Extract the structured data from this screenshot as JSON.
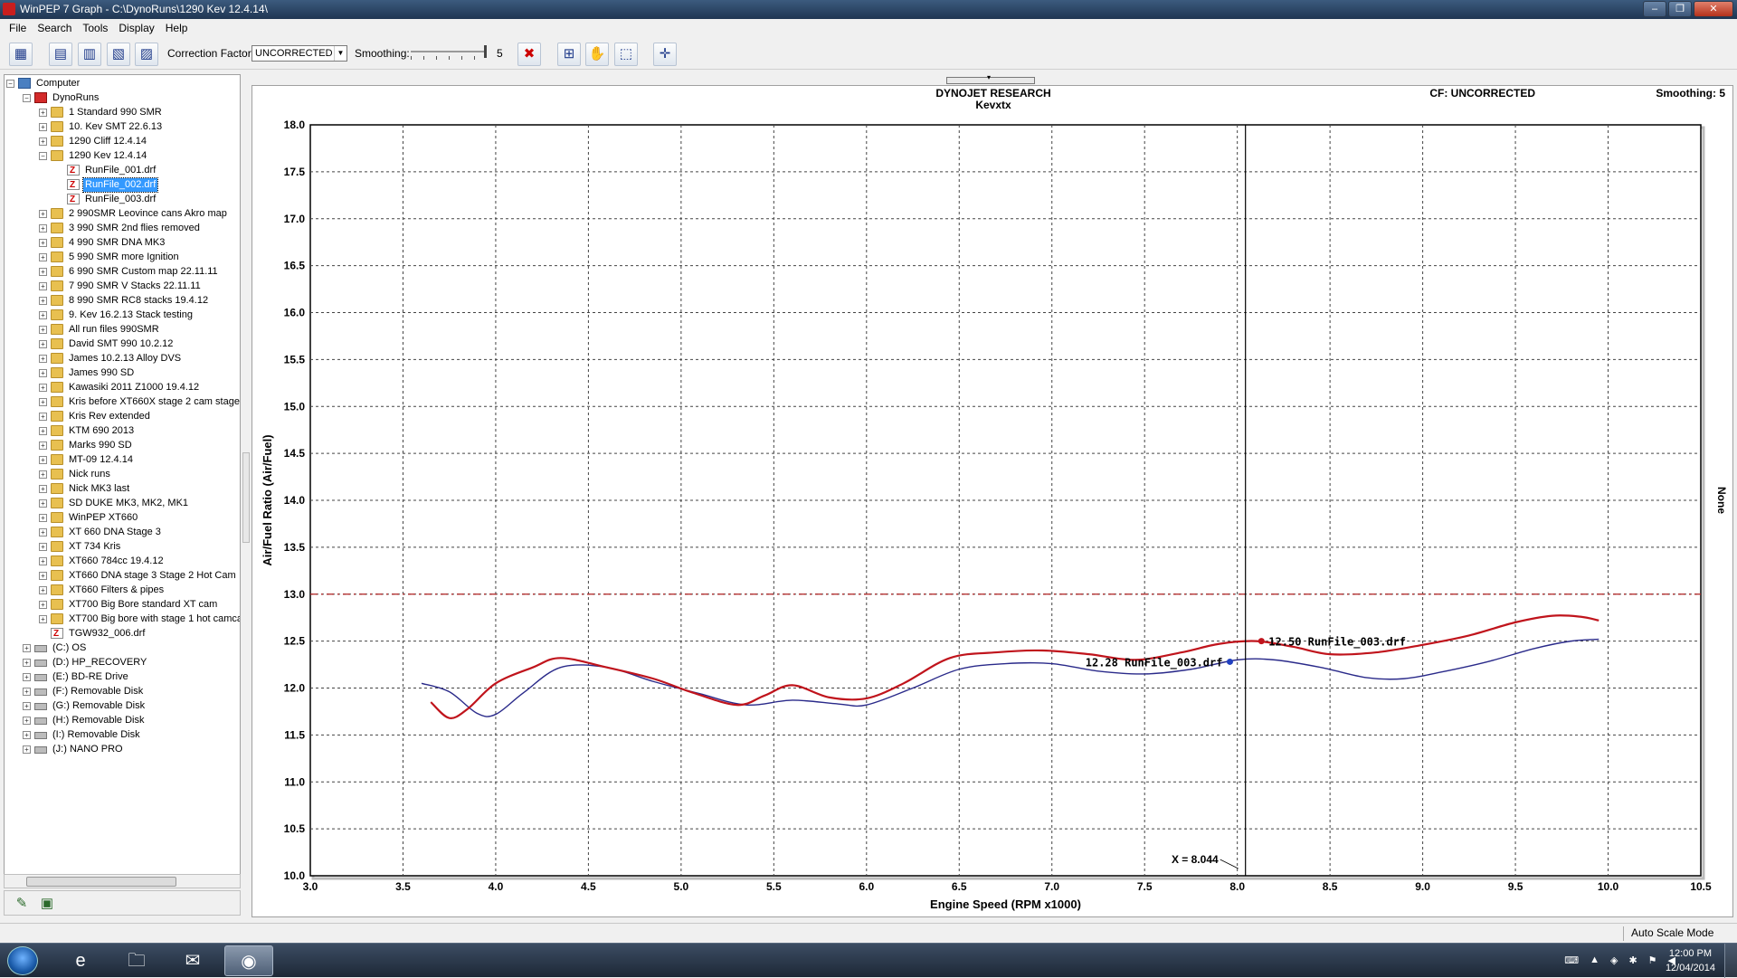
{
  "window": {
    "title": "WinPEP 7    Graph - C:\\DynoRuns\\1290 Kev 12.4.14\\"
  },
  "menu": [
    "File",
    "Search",
    "Tools",
    "Display",
    "Help"
  ],
  "toolbar": {
    "correction_label": "Correction Factor:",
    "correction_value": "UNCORRECTED",
    "smoothing_label": "Smoothing:",
    "smoothing_value": "5"
  },
  "tree": {
    "root": "Computer",
    "dyno_folder": "DynoRuns",
    "items": [
      "1 Standard 990 SMR",
      "10. Kev SMT 22.6.13",
      "1290 Cliff 12.4.14",
      "1290 Kev 12.4.14",
      "RunFile_001.drf",
      "RunFile_002.drf",
      "RunFile_003.drf",
      "2 990SMR Leovince cans Akro map",
      "3 990 SMR 2nd flies removed",
      "4 990 SMR DNA MK3",
      "5 990 SMR more Ignition",
      "6 990 SMR Custom map 22.11.11",
      "7 990 SMR  V Stacks 22.11.11",
      "8 990 SMR RC8 stacks 19.4.12",
      "9. Kev 16.2.13 Stack testing",
      "All run files 990SMR",
      "David SMT 990 10.2.12",
      "James 10.2.13 Alloy DVS",
      "James 990 SD",
      "Kawasiki 2011 Z1000 19.4.12",
      "Kris before XT660X stage 2 cam stage",
      "Kris Rev extended",
      "KTM 690 2013",
      "Marks 990 SD",
      "MT-09 12.4.14",
      "Nick  runs",
      "Nick MK3 last",
      "SD DUKE MK3, MK2, MK1",
      "WinPEP XT660",
      "XT 660 DNA Stage 3",
      "XT 734 Kris",
      "XT660 784cc 19.4.12",
      "XT660 DNA stage 3 Stage 2 Hot Cam",
      "XT660 Filters & pipes",
      "XT700 Big Bore standard XT cam",
      "XT700 Big bore with stage 1 hot camca",
      "TGW932_006.drf"
    ],
    "drives": [
      "(C:)  OS",
      "(D:)  HP_RECOVERY",
      "(E:)  BD-RE Drive",
      "(F:)  Removable Disk",
      "(G:)  Removable Disk",
      "(H:)  Removable Disk",
      "(I:)  Removable Disk",
      "(J:)  NANO PRO"
    ]
  },
  "graph": {
    "title": "DYNOJET RESEARCH",
    "subtitle": "Kevxtx",
    "cf_info": "CF: UNCORRECTED",
    "smoothing_info": "Smoothing: 5",
    "right_axis_label": "None",
    "cursor_readout": "X = 8.044",
    "red_label": "12.50 RunFile_003.drf",
    "blue_label": "12.28 RunFile_003.drf"
  },
  "chart_data": {
    "type": "line",
    "xlabel": "Engine Speed (RPM x1000)",
    "ylabel": "Air/Fuel Ratio (Air/Fuel)",
    "xlim": [
      3.0,
      10.5
    ],
    "ylim": [
      10.0,
      18.0
    ],
    "xticks": [
      "3.0",
      "3.5",
      "4.0",
      "4.5",
      "5.0",
      "5.5",
      "6.0",
      "6.5",
      "7.0",
      "7.5",
      "8.0",
      "8.5",
      "9.0",
      "9.5",
      "10.0",
      "10.5"
    ],
    "yticks": [
      "10.0",
      "10.5",
      "11.0",
      "11.5",
      "12.0",
      "12.5",
      "13.0",
      "13.5",
      "14.0",
      "14.5",
      "15.0",
      "15.5",
      "16.0",
      "16.5",
      "17.0",
      "17.5",
      "18.0"
    ],
    "grid": true,
    "reference_line": 13.0,
    "cursor_x": 8.044,
    "series": [
      {
        "color": "#c0141c",
        "x": [
          3.65,
          3.75,
          3.85,
          4.0,
          4.2,
          4.35,
          4.6,
          4.85,
          5.05,
          5.3,
          5.45,
          5.6,
          5.8,
          6.0,
          6.2,
          6.45,
          6.7,
          6.95,
          7.2,
          7.45,
          7.7,
          7.9,
          8.1,
          8.3,
          8.5,
          8.75,
          9.0,
          9.25,
          9.5,
          9.7,
          9.85,
          9.95
        ],
        "y": [
          11.85,
          11.68,
          11.78,
          12.05,
          12.22,
          12.32,
          12.22,
          12.1,
          11.96,
          11.82,
          11.92,
          12.03,
          11.9,
          11.89,
          12.05,
          12.32,
          12.38,
          12.4,
          12.36,
          12.3,
          12.38,
          12.47,
          12.5,
          12.44,
          12.36,
          12.38,
          12.46,
          12.56,
          12.7,
          12.77,
          12.76,
          12.72
        ]
      },
      {
        "color": "#2a2a8a",
        "x": [
          3.6,
          3.75,
          3.9,
          4.0,
          4.15,
          4.35,
          4.6,
          4.85,
          5.1,
          5.35,
          5.6,
          5.85,
          6.0,
          6.25,
          6.5,
          6.75,
          7.0,
          7.25,
          7.5,
          7.75,
          8.0,
          8.2,
          8.45,
          8.7,
          8.9,
          9.1,
          9.35,
          9.6,
          9.8,
          9.95
        ],
        "y": [
          12.05,
          11.96,
          11.73,
          11.72,
          11.95,
          12.22,
          12.22,
          12.07,
          11.94,
          11.82,
          11.87,
          11.83,
          11.82,
          12.0,
          12.2,
          12.26,
          12.26,
          12.18,
          12.15,
          12.2,
          12.3,
          12.3,
          12.22,
          12.11,
          12.1,
          12.17,
          12.28,
          12.42,
          12.5,
          12.52
        ]
      }
    ]
  },
  "status": {
    "mode": "Auto Scale Mode"
  },
  "clock": {
    "time": "12:00 PM",
    "date": "12/04/2014"
  }
}
